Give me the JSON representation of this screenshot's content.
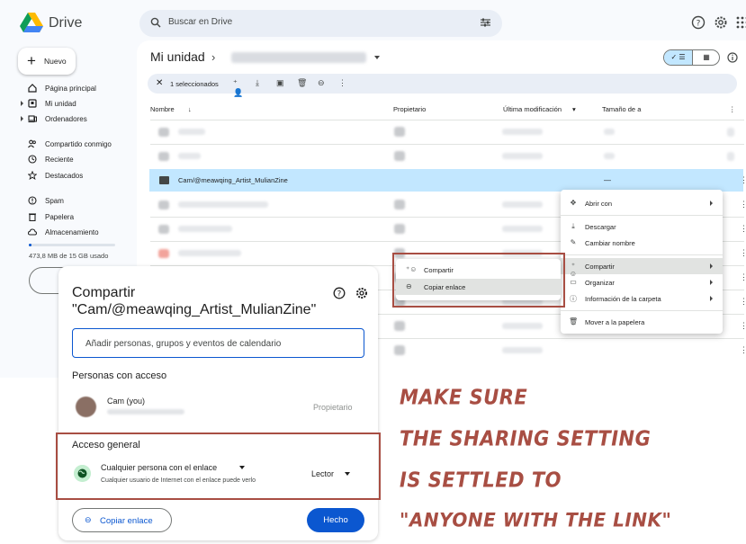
{
  "app": {
    "name": "Drive"
  },
  "search": {
    "placeholder": "Buscar en Drive"
  },
  "sidebar": {
    "new_label": "Nuevo",
    "items": [
      {
        "label": "Página principal",
        "icon": "home-icon"
      },
      {
        "label": "Mi unidad",
        "icon": "drive-icon"
      },
      {
        "label": "Ordenadores",
        "icon": "computer-icon"
      },
      {
        "label": "Compartido conmigo",
        "icon": "people-icon"
      },
      {
        "label": "Reciente",
        "icon": "clock-icon"
      },
      {
        "label": "Destacados",
        "icon": "star-icon"
      },
      {
        "label": "Spam",
        "icon": "spam-icon"
      },
      {
        "label": "Papelera",
        "icon": "trash-icon"
      },
      {
        "label": "Almacenamiento",
        "icon": "cloud-icon"
      }
    ],
    "storage_text": "473,8 MB de 15 GB usado",
    "storage_fraction": 0.03
  },
  "main": {
    "breadcrumb": "Mi unidad",
    "selection_text": "1 seleccionados",
    "columns": [
      "Nombre",
      "Propietario",
      "Última modificación",
      "Tamaño de a"
    ],
    "selected_row": {
      "name": "Cam/@meawqing_Artist_MulianZine",
      "size": "—"
    }
  },
  "context_menu": {
    "items": [
      {
        "label": "Abrir con",
        "icon": "move-icon",
        "submenu": true
      },
      {
        "label": "Descargar",
        "icon": "download-icon",
        "submenu": false
      },
      {
        "label": "Cambiar nombre",
        "icon": "pencil-icon",
        "submenu": false
      },
      {
        "label": "Compartir",
        "icon": "person-add-icon",
        "submenu": true
      },
      {
        "label": "Organizar",
        "icon": "folder-open-icon",
        "submenu": true
      },
      {
        "label": "Información de la carpeta",
        "icon": "info-icon",
        "submenu": true
      },
      {
        "label": "Mover a la papelera",
        "icon": "trash-icon",
        "submenu": false
      }
    ]
  },
  "share_submenu": {
    "items": [
      {
        "label": "Compartir",
        "icon": "person-add-icon"
      },
      {
        "label": "Copiar enlace",
        "icon": "link-icon"
      }
    ]
  },
  "share_dialog": {
    "title": "Compartir",
    "file_name": "\"Cam/@meawqing_Artist_MulianZine\"",
    "input_placeholder": "Añadir personas, grupos y eventos de calendario",
    "people_heading": "Personas con acceso",
    "person_name": "Cam (you)",
    "person_role": "Propietario",
    "general_heading": "Acceso general",
    "access_option": "Cualquier persona con el enlace",
    "access_description": "Cualquier usuario de Internet con el enlace puede verlo",
    "role": "Lector",
    "copy_link_label": "Copiar enlace",
    "done_label": "Hecho"
  },
  "annotation": {
    "lines": [
      "MAKE SURE",
      "THE SHARING SETTING",
      "IS SETTLED TO",
      "\"ANYONE WITH THE LINK\""
    ],
    "color": "#a84e43"
  },
  "colors": {
    "accent": "#0b57d0",
    "selected_row": "#c2e7ff",
    "annotation": "#a84e43"
  }
}
